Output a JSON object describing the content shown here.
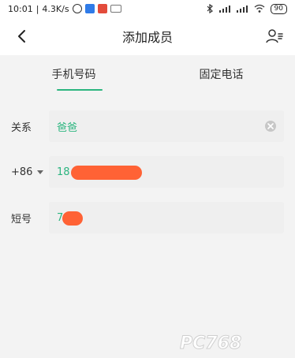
{
  "status": {
    "time": "10:01",
    "speed": "4.3K/s",
    "battery": "90"
  },
  "header": {
    "title": "添加成员"
  },
  "tabs": [
    {
      "label": "手机号码",
      "active": true
    },
    {
      "label": "固定电话",
      "active": false
    }
  ],
  "form": {
    "relation_label": "关系",
    "relation_value": "爸爸",
    "country_code": "+86",
    "phone_prefix": "18",
    "shortcode_label": "短号",
    "shortcode_prefix": "7"
  },
  "watermark": {
    "text": "PC768"
  },
  "colors": {
    "accent": "#2bb57f",
    "redaction": "#ff5a2a"
  }
}
